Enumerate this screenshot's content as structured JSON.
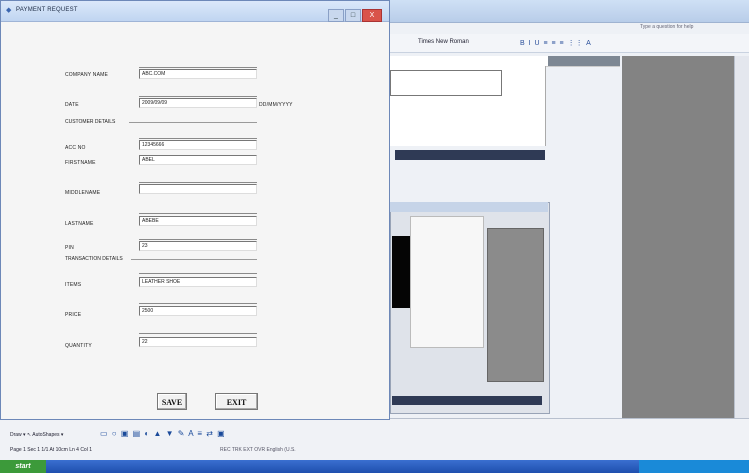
{
  "background_app": {
    "help_text": "Type a question for help",
    "font_name": "Times New Roman",
    "status_left": "Page 1    Sec 1    1/1    At 10cm    Ln 4    Col 1",
    "status_right": "REC  TRK  EXT  OVR  English (U.S.",
    "draw_menu": "Draw ▾  ↖  AutoShapes ▾",
    "start_label": "start"
  },
  "dialog": {
    "title": "PAYMENT REQUEST",
    "controls": {
      "minimize": "_",
      "maximize": "□",
      "close": "X"
    },
    "company": {
      "label": "COMPANY NAME",
      "value": "ABC.COM"
    },
    "date": {
      "label": "DATE",
      "value": "2009/09/09",
      "format_hint": "DD/MM/YYYY"
    },
    "customer_section": "CUSTOMER DETAILS",
    "account": {
      "label": "ACC NO",
      "value": "12345666"
    },
    "first_name": {
      "label": "FIRSTNAME",
      "value": "ABEL"
    },
    "middle_name": {
      "label": "MIDDLENAME",
      "value": ""
    },
    "last_name": {
      "label": "LASTNAME",
      "value": "ABEBE"
    },
    "pin": {
      "label": "PIN",
      "value": "23"
    },
    "transaction_section": "TRANSACTION DETAILS",
    "items": {
      "label": "ITEMS",
      "value": "LEATHER SHOE"
    },
    "price": {
      "label": "PRICE",
      "value": "2500"
    },
    "quantity": {
      "label": "QUANTITY",
      "value": "22"
    },
    "save_label": "SAVE",
    "exit_label": "EXIT"
  }
}
